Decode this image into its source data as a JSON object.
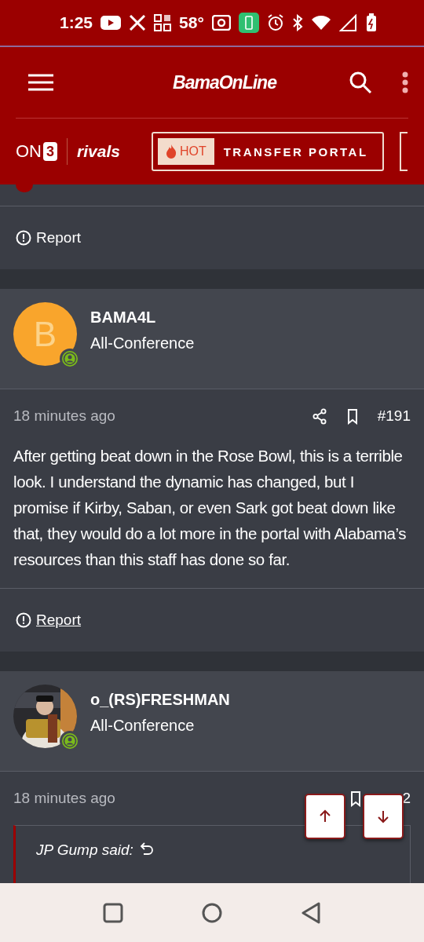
{
  "status_bar": {
    "time": "1:25",
    "temperature": "58°"
  },
  "header": {
    "logo": "BamaOnLine"
  },
  "nav": {
    "on3_logo": "ON",
    "on3_digit": "3",
    "rivals_logo": "rivals",
    "hot_badge": "HOT",
    "link": "TRANSFER PORTAL"
  },
  "posts": [
    {
      "kind": "tail",
      "report": {
        "label": "Report",
        "underlined": false
      }
    },
    {
      "kind": "full",
      "author": {
        "name": "BAMA4L",
        "title": "All-Conference",
        "avatar": {
          "kind": "letter",
          "letter": "B"
        }
      },
      "time": "18 minutes ago",
      "number": "#191",
      "body": "After getting beat down in the Rose Bowl, this is a terrible look. I understand the dynamic has changed, but I promise if Kirby, Saban, or even Sark got beat down like that, they would do a lot more in the portal with Alabama’s resources than this staff has done so far.",
      "report": {
        "label": "Report",
        "underlined": true
      }
    },
    {
      "kind": "partial",
      "author": {
        "name": "o_(RS)FRESHMAN",
        "title": "All-Conference"
      },
      "time": "18 minutes ago",
      "number": "2",
      "quote": "JP Gump said:"
    }
  ]
}
